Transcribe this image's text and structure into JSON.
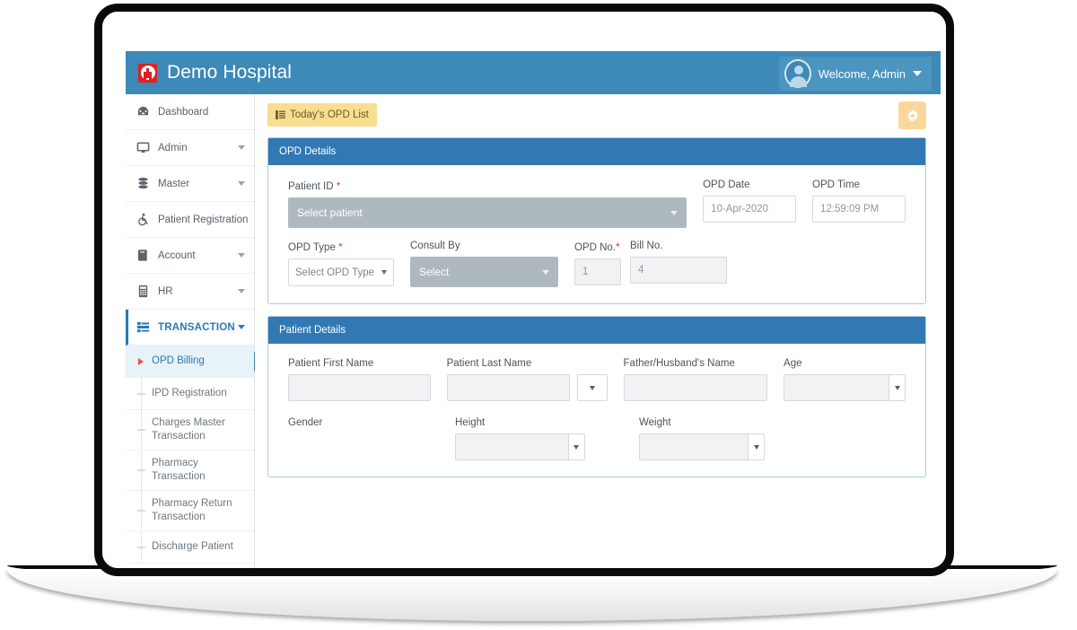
{
  "header": {
    "brand_title": "Demo Hospital",
    "logo_icon": "red-cross-icon",
    "user_label": "Welcome, Admin",
    "brand_color": "#3d89b7"
  },
  "sidebar": {
    "items": [
      {
        "label": "Dashboard",
        "icon": "dashboard-gauge-icon",
        "has_chevron": false,
        "active": false
      },
      {
        "label": "Admin",
        "icon": "monitor-icon",
        "has_chevron": true,
        "active": false
      },
      {
        "label": "Master",
        "icon": "database-icon",
        "has_chevron": true,
        "active": false
      },
      {
        "label": "Patient Registration",
        "icon": "wheelchair-icon",
        "has_chevron": false,
        "active": false
      },
      {
        "label": "Account",
        "icon": "ledger-book-icon",
        "has_chevron": true,
        "active": false
      },
      {
        "label": "HR",
        "icon": "calculator-icon",
        "has_chevron": true,
        "active": false
      },
      {
        "label": "TRANSACTION",
        "icon": "transaction-list-icon",
        "has_chevron": true,
        "active": true
      }
    ],
    "submenu": [
      {
        "label": "OPD Billing",
        "active": true
      },
      {
        "label": "IPD Registration",
        "active": false
      },
      {
        "label": "Charges Master Transaction",
        "active": false
      },
      {
        "label": "Pharmacy Transaction",
        "active": false
      },
      {
        "label": "Pharmacy Return Transaction",
        "active": false
      },
      {
        "label": "Discharge Patient",
        "active": false
      }
    ],
    "active_color": "#2a7ab0"
  },
  "toolbar": {
    "opd_list_label": "Today's OPD List",
    "opd_list_icon": "list-icon",
    "opd_list_color": "#fade8f",
    "gear_icon": "gear-icon",
    "gear_color": "#fcd79b"
  },
  "opd_details": {
    "panel_title": "OPD Details",
    "panel_color": "#3279b4",
    "patient_id_label": "Patient ID",
    "patient_id_required": "*",
    "patient_id_value": "Select patient",
    "opd_date_label": "OPD Date",
    "opd_date_value": "10-Apr-2020",
    "opd_time_label": "OPD Time",
    "opd_time_value": "12:59:09 PM",
    "opd_type_label": "OPD Type",
    "opd_type_required": "*",
    "opd_type_value": "Select OPD Type",
    "consult_by_label": "Consult By",
    "consult_by_value": "Select",
    "opd_no_label": "OPD No.",
    "opd_no_required": "*",
    "opd_no_value": "1",
    "bill_no_label": "Bill No.",
    "bill_no_value": "4"
  },
  "patient_details": {
    "panel_title": "Patient Details",
    "first_name_label": "Patient First Name",
    "first_name_value": "",
    "last_name_label": "Patient Last Name",
    "last_name_value": "",
    "father_husband_label": "Father/Husband's Name",
    "father_husband_value": "",
    "age_label": "Age",
    "age_value": "",
    "gender_label": "Gender",
    "height_label": "Height",
    "height_value": "",
    "weight_label": "Weight",
    "weight_value": ""
  }
}
